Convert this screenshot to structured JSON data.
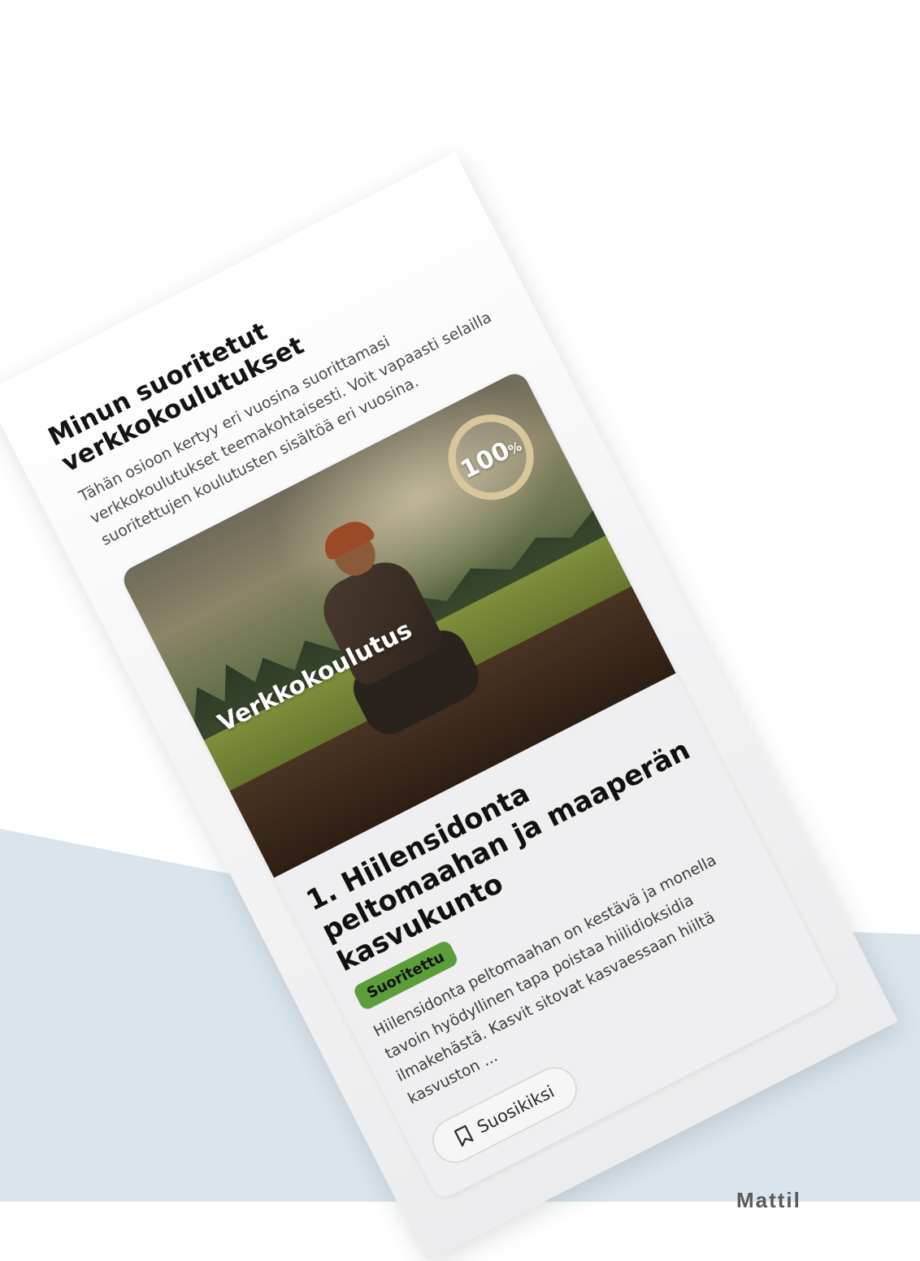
{
  "panel": {
    "title": "Minun suoritetut verkkokoulutukset",
    "description": "Tähän osioon kertyy eri vuosina suorittamasi verkkokoulutukset teemakohtaisesti. Voit vapaasti selailla suoritettujen koulutusten sisältöä eri vuosina."
  },
  "card": {
    "tag": "Verkkokoulutus",
    "progress": {
      "value": "100",
      "unit": "%",
      "fraction": 1.0
    },
    "title": "1. Hiilensidonta peltomaahan ja maaperän kasvukunto",
    "status": "Suoritettu",
    "description": "Hiilensidonta peltomaahan on kestävä ja monella tavoin hyödyllinen tapa poistaa hiilidioksidia ilmakehästä. Kasvit sitovat kasvaessaan hiiltä kasvuston ...",
    "favorite_label": "Suosikiksi",
    "favorite_icon": "bookmark-icon"
  },
  "footer_fragment": "Mattil",
  "colors": {
    "status_green": "#5c9e3a",
    "progress_ring": "#d8c79a",
    "background_shape": "#d9e4ec"
  }
}
